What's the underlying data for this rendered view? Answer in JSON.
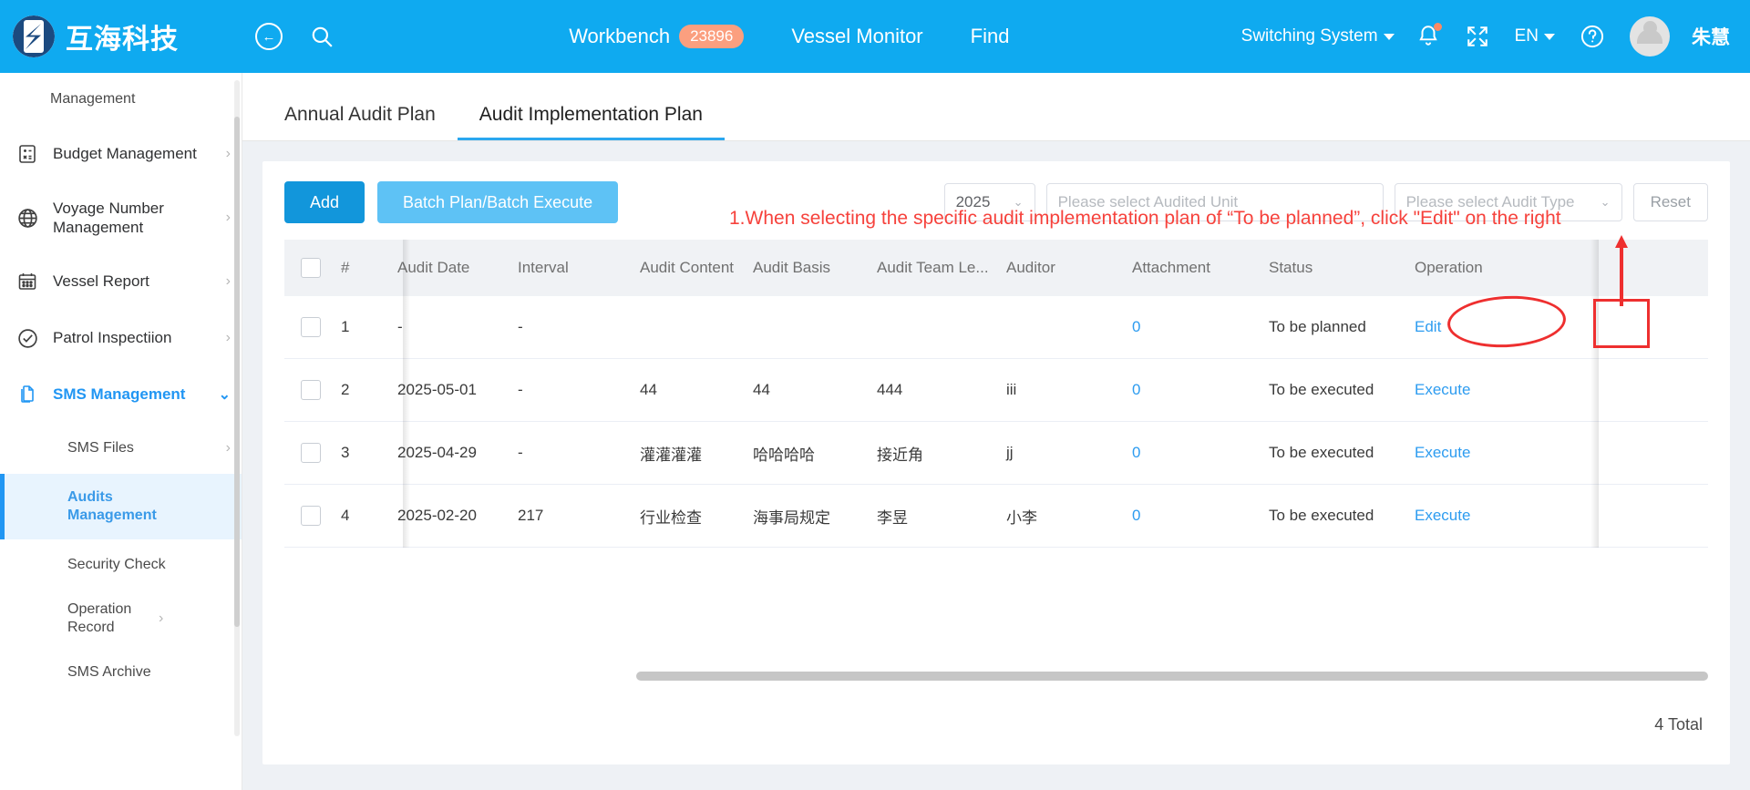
{
  "header": {
    "brand_name": "互海科技",
    "back_icon": "back-arrow-icon",
    "search_icon": "search-icon",
    "nav": [
      {
        "label": "Workbench",
        "badge": "23896"
      },
      {
        "label": "Vessel Monitor",
        "badge": ""
      },
      {
        "label": "Find",
        "badge": ""
      }
    ],
    "switching_system": "Switching System",
    "language": "EN",
    "user_name": "朱慧"
  },
  "sidebar": {
    "items": [
      {
        "label": "Management",
        "icon": "",
        "arrow": "",
        "level": "sub-text",
        "state": "normal"
      },
      {
        "label": "Budget Management",
        "icon": "calculator-icon",
        "arrow": "›",
        "level": "parent",
        "state": "normal"
      },
      {
        "label": "Voyage Number Management",
        "icon": "globe-icon",
        "arrow": "›",
        "level": "parent",
        "state": "normal"
      },
      {
        "label": "Vessel Report",
        "icon": "calendar-icon",
        "arrow": "›",
        "level": "parent",
        "state": "normal"
      },
      {
        "label": "Patrol Inspectiion",
        "icon": "check-circle-icon",
        "arrow": "›",
        "level": "parent",
        "state": "normal"
      },
      {
        "label": "SMS Management",
        "icon": "documents-icon",
        "arrow": "⌄",
        "level": "parent",
        "state": "active"
      },
      {
        "label": "SMS Files",
        "icon": "",
        "arrow": "›",
        "level": "sub",
        "state": "normal"
      },
      {
        "label": "Audits Management",
        "icon": "",
        "arrow": "",
        "level": "sub",
        "state": "selected"
      },
      {
        "label": "Security Check",
        "icon": "",
        "arrow": "",
        "level": "sub",
        "state": "normal"
      },
      {
        "label": "Operation Record",
        "icon": "",
        "arrow": "›",
        "level": "sub",
        "state": "normal"
      },
      {
        "label": "SMS Archive",
        "icon": "",
        "arrow": "",
        "level": "sub",
        "state": "normal"
      }
    ]
  },
  "tabs": [
    {
      "label": "Annual Audit Plan",
      "active": false
    },
    {
      "label": "Audit Implementation Plan",
      "active": true
    }
  ],
  "toolbar": {
    "add_label": "Add",
    "batch_label": "Batch Plan/Batch Execute",
    "year_value": "2025",
    "audited_unit_placeholder": "Please select Audited Unit",
    "audit_type_placeholder": "Please select Audit Type",
    "reset_label": "Reset"
  },
  "table": {
    "columns": [
      "#",
      "Audit Date",
      "Interval",
      "Audit Content",
      "Audit Basis",
      "Audit Team Le...",
      "Auditor",
      "Attachment",
      "Status",
      "Operation"
    ],
    "rows": [
      {
        "idx": "1",
        "date": "-",
        "interval": "-",
        "content": "",
        "basis": "",
        "leader": "",
        "auditor": "",
        "attachment": "0",
        "status": "To be planned",
        "operation": "Edit"
      },
      {
        "idx": "2",
        "date": "2025-05-01",
        "interval": "-",
        "content": "44",
        "basis": "44",
        "leader": "444",
        "auditor": "iii",
        "attachment": "0",
        "status": "To be executed",
        "operation": "Execute"
      },
      {
        "idx": "3",
        "date": "2025-04-29",
        "interval": "-",
        "content": "灌灌灌灌",
        "basis": "哈哈哈哈",
        "leader": "接近角",
        "auditor": "jj",
        "attachment": "0",
        "status": "To be executed",
        "operation": "Execute"
      },
      {
        "idx": "4",
        "date": "2025-02-20",
        "interval": "217",
        "content": "行业检查",
        "basis": "海事局规定",
        "leader": "李昱",
        "auditor": "小李",
        "attachment": "0",
        "status": "To be executed",
        "operation": "Execute"
      }
    ],
    "total_label": "4 Total"
  },
  "annotation": {
    "text": "1.When selecting the specific audit implementation plan of “To be planned”, click \"Edit\" on the right",
    "color": "#f6423c"
  },
  "colors": {
    "header_blue": "#0faaf0",
    "accent_blue": "#2d9cf0",
    "badge_orange": "#fb9f7f",
    "annotation_red": "#ee2f2f"
  }
}
